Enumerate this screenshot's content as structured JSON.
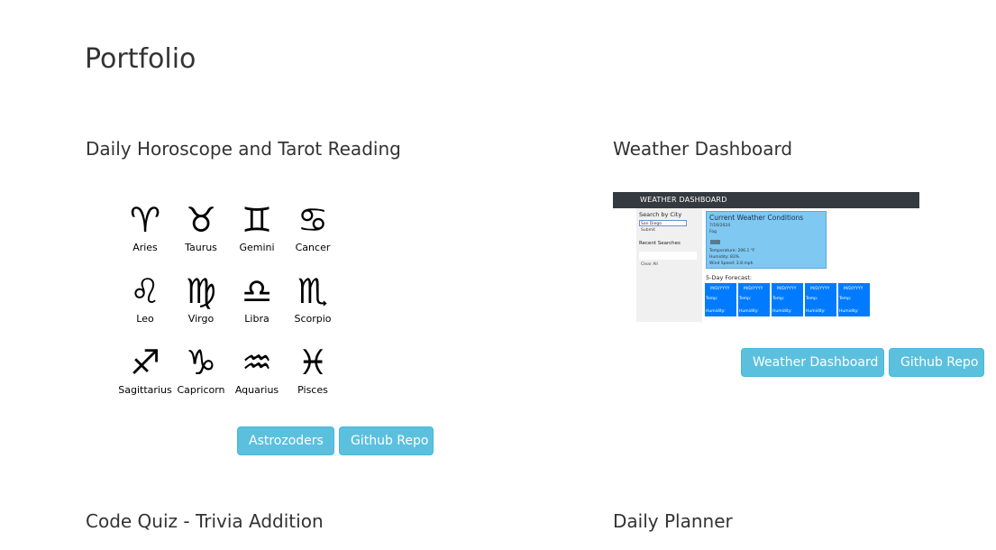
{
  "page": {
    "title": "Portfolio"
  },
  "projects": [
    {
      "title": "Daily Horoscope and Tarot Reading",
      "zodiac": [
        {
          "glyph": "♈",
          "name": "Aries"
        },
        {
          "glyph": "♉",
          "name": "Taurus"
        },
        {
          "glyph": "♊",
          "name": "Gemini"
        },
        {
          "glyph": "♋",
          "name": "Cancer"
        },
        {
          "glyph": "♌",
          "name": "Leo"
        },
        {
          "glyph": "♍",
          "name": "Virgo"
        },
        {
          "glyph": "♎",
          "name": "Libra"
        },
        {
          "glyph": "♏",
          "name": "Scorpio"
        },
        {
          "glyph": "♐",
          "name": "Sagittarius"
        },
        {
          "glyph": "♑",
          "name": "Capricorn"
        },
        {
          "glyph": "♒",
          "name": "Aquarius"
        },
        {
          "glyph": "♓",
          "name": "Pisces"
        }
      ],
      "buttons": {
        "live": "Astrozoders",
        "repo": "Github Repo"
      }
    },
    {
      "title": "Weather Dashboard",
      "thumbnail": {
        "header": "WEATHER DASHBOARD",
        "search_label": "Search by City",
        "search_value": "San Diego",
        "submit": "Submit",
        "recent_label": "Recent Searches",
        "clear": "Clear All",
        "current_title": "Current Weather Conditions",
        "current_date": "7/16/2024",
        "current_city": "Fog",
        "temperature": "Temperature: 206.1 °F",
        "humidity": "Humidity: 83%",
        "wind": "Wind Speed: 3.8 mph",
        "forecast_title": "5-Day Forecast:",
        "forecast": [
          {
            "date": "M/D/YYYY",
            "temp": "Temp:",
            "humidity": "Humidity:"
          },
          {
            "date": "M/D/YYYY",
            "temp": "Temp:",
            "humidity": "Humidity:"
          },
          {
            "date": "M/D/YYYY",
            "temp": "Temp:",
            "humidity": "Humidity:"
          },
          {
            "date": "M/D/YYYY",
            "temp": "Temp:",
            "humidity": "Humidity:"
          },
          {
            "date": "M/D/YYYY",
            "temp": "Temp:",
            "humidity": "Humidity:"
          }
        ]
      },
      "buttons": {
        "live": "Weather Dashboard",
        "repo": "Github Repo"
      }
    },
    {
      "title": "Code Quiz - Trivia Addition"
    },
    {
      "title": "Daily Planner"
    }
  ],
  "colors": {
    "button_bg": "#5bc0de",
    "button_border": "#46b8da",
    "text": "#333333",
    "thumb_header": "#343a40",
    "thumb_current": "#7ec8f2",
    "thumb_card": "#007bff"
  }
}
